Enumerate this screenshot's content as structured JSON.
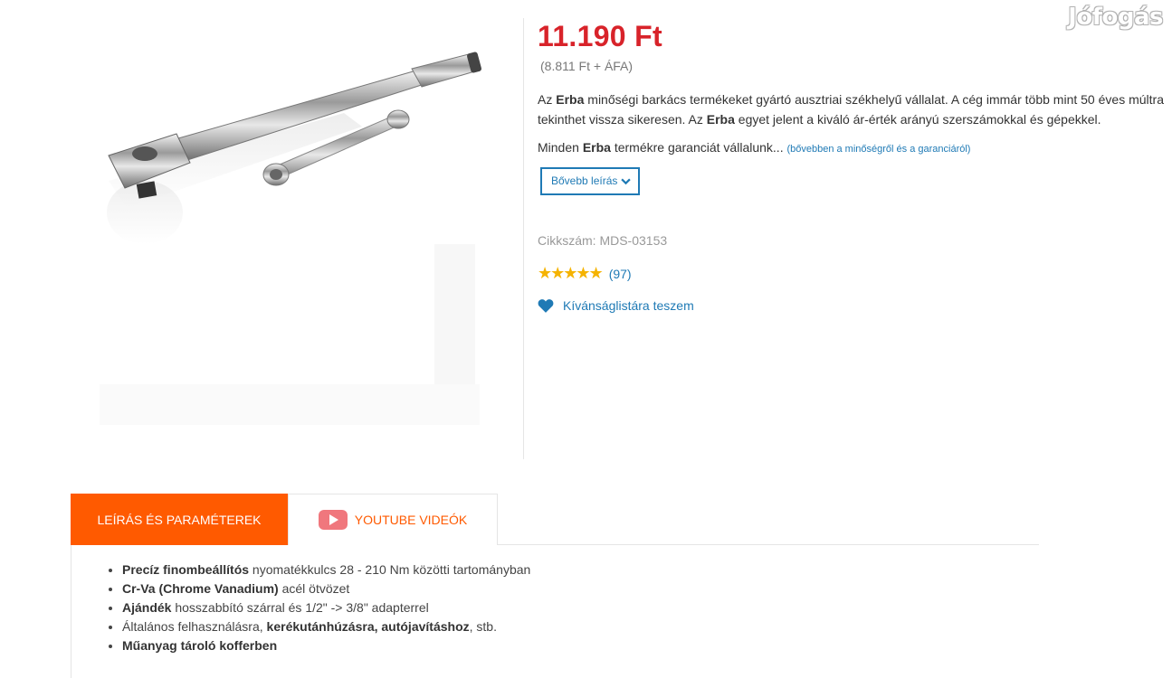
{
  "watermark": "Jófogás",
  "product": {
    "price": "11.190 Ft",
    "price_net": "(8.811 Ft + ÁFA)",
    "desc": {
      "p1_a": "Az ",
      "p1_brand1": "Erba",
      "p1_b": " minőségi barkács termékeket gyártó ausztriai székhelyű vállalat. A cég immár több mint 50 éves múltra tekinthet vissza sikeresen. Az ",
      "p1_brand2": "Erba",
      "p1_c": " egyet jelent a kiváló ár-érték arányú szerszámokkal és gépekkel.",
      "p2_a": "Minden ",
      "p2_brand": "Erba",
      "p2_b": " termékre garanciát vállalunk...",
      "more_link": "(bővebben a minőségről és a garanciáról)"
    },
    "more_button": "Bővebb leírás",
    "sku": "Cikkszám: MDS-03153",
    "rating": {
      "stars": "★★★★★",
      "value": 5,
      "count": "(97)"
    },
    "wishlist": "Kívánságlistára teszem"
  },
  "tabs": [
    {
      "label": "LEÍRÁS ÉS PARAMÉTEREK",
      "active": true
    },
    {
      "label": "YOUTUBE VIDEÓK",
      "active": false,
      "icon": "youtube-icon"
    }
  ],
  "features": [
    {
      "bold": "Precíz finombeállítós",
      "text": " nyomatékkulcs 28 - 210 Nm közötti tartományban"
    },
    {
      "bold": "Cr-Va (Chrome Vanadium)",
      "text": " acél ötvözet"
    },
    {
      "bold": "Ajándék",
      "text": " hosszabbító szárral és 1/2\" -> 3/8\" adapterrel"
    },
    {
      "pre": "Általános felhasználásra, ",
      "bold": "kerékutánhúzásra, autójavításhoz",
      "text": ", stb."
    },
    {
      "bold": "Műanyag tároló kofferben",
      "text": ""
    }
  ],
  "colors": {
    "price": "#d8232a",
    "accent": "#ff5a00",
    "link": "#1f7ab5",
    "star": "#f5b301"
  }
}
